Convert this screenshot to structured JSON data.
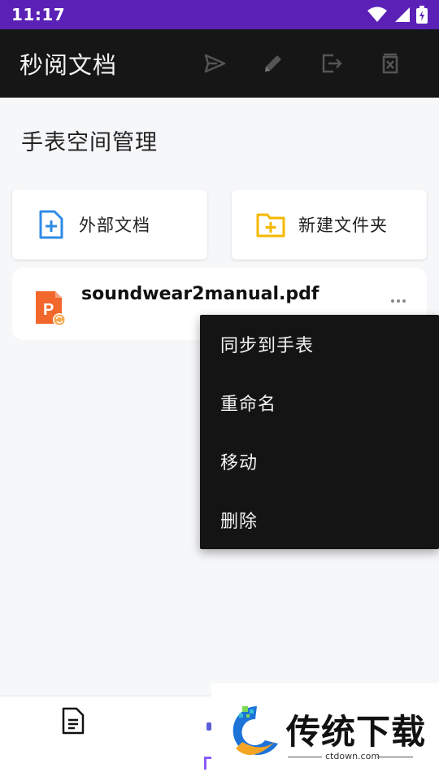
{
  "status_bar": {
    "time": "11:17",
    "icons": [
      "wifi-icon",
      "signal-icon",
      "battery-charging-icon"
    ],
    "background": "#5b21b6"
  },
  "app_bar": {
    "title": "秒阅文档",
    "actions": [
      "send-icon",
      "edit-icon",
      "exit-icon",
      "delete-icon"
    ],
    "background": "#161616"
  },
  "page": {
    "section_title": "手表空间管理"
  },
  "cards": [
    {
      "label": "外部文档",
      "icon": "file-add-icon",
      "color": "#2f8be6"
    },
    {
      "label": "新建文件夹",
      "icon": "folder-add-icon",
      "color": "#f5b800"
    }
  ],
  "file": {
    "name": "soundwear2manual.pdf",
    "icon": "ppt-file-sync-icon",
    "icon_color": "#f2682c"
  },
  "context_menu": {
    "items": [
      "同步到手表",
      "重命名",
      "移动",
      "删除"
    ],
    "background": "#141414"
  },
  "bottom_nav": {
    "items": [
      "document-icon"
    ]
  },
  "watermark": {
    "brand": "传统下载",
    "site": "ctdown.com"
  }
}
